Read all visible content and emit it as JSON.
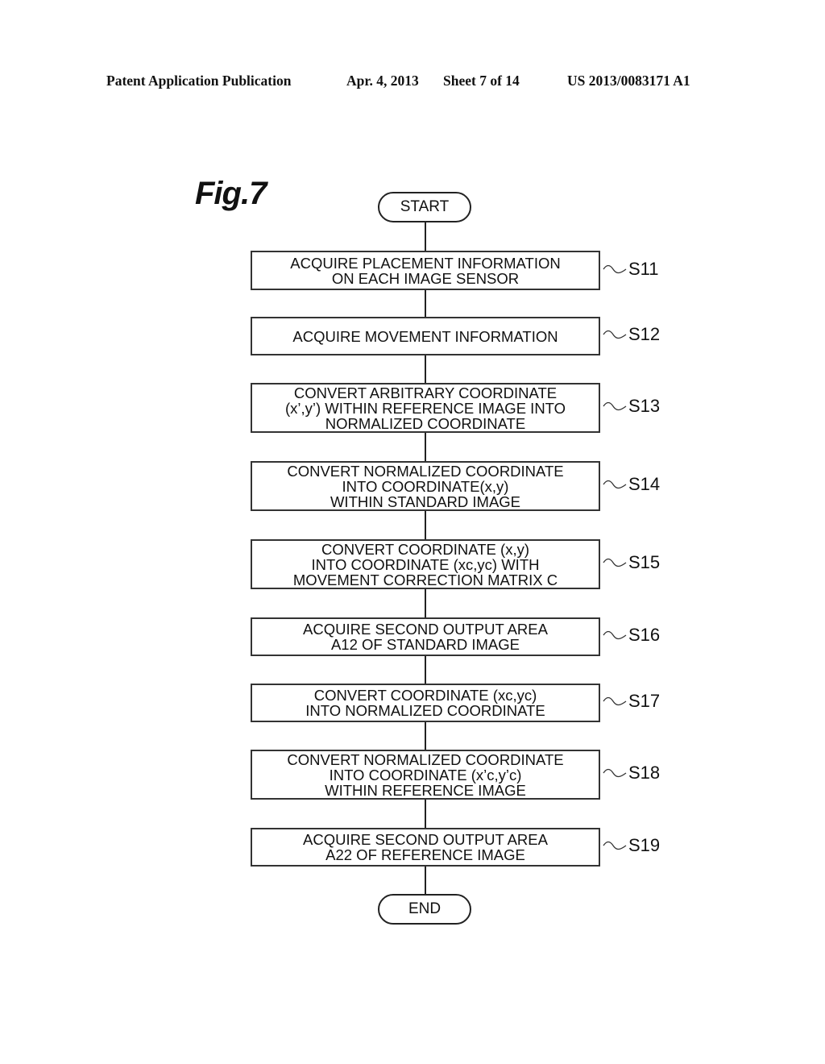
{
  "header": {
    "publication": "Patent Application Publication",
    "date": "Apr. 4, 2013",
    "sheet": "Sheet 7 of 14",
    "number": "US 2013/0083171 A1"
  },
  "figure": {
    "title": "Fig.7",
    "start": "START",
    "end": "END",
    "steps": [
      {
        "id": "S11",
        "lines": [
          "ACQUIRE PLACEMENT INFORMATION",
          "ON EACH IMAGE SENSOR"
        ]
      },
      {
        "id": "S12",
        "lines": [
          "ACQUIRE MOVEMENT INFORMATION"
        ]
      },
      {
        "id": "S13",
        "lines": [
          "CONVERT ARBITRARY COORDINATE",
          "(x’,y’) WITHIN REFERENCE IMAGE INTO",
          "NORMALIZED COORDINATE"
        ]
      },
      {
        "id": "S14",
        "lines": [
          "CONVERT NORMALIZED COORDINATE",
          "INTO COORDINATE(x,y)",
          "WITHIN STANDARD IMAGE"
        ]
      },
      {
        "id": "S15",
        "lines": [
          "CONVERT COORDINATE (x,y)",
          "INTO COORDINATE (xc,yc) WITH",
          "MOVEMENT CORRECTION MATRIX C"
        ]
      },
      {
        "id": "S16",
        "lines": [
          "ACQUIRE SECOND OUTPUT AREA",
          "A12 OF STANDARD IMAGE"
        ]
      },
      {
        "id": "S17",
        "lines": [
          "CONVERT COORDINATE (xc,yc)",
          "INTO NORMALIZED COORDINATE"
        ]
      },
      {
        "id": "S18",
        "lines": [
          "CONVERT NORMALIZED COORDINATE",
          "INTO COORDINATE (x’c,y’c)",
          "WITHIN REFERENCE IMAGE"
        ]
      },
      {
        "id": "S19",
        "lines": [
          "ACQUIRE SECOND OUTPUT AREA",
          "A22 OF REFERENCE IMAGE"
        ]
      }
    ]
  }
}
